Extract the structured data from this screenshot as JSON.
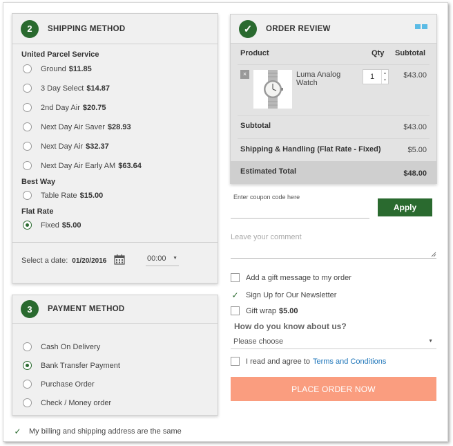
{
  "shipping": {
    "step": "2",
    "title": "SHIPPING METHOD",
    "groups": [
      {
        "label": "United Parcel Service",
        "options": [
          {
            "label": "Ground",
            "price": "$11.85",
            "selected": false
          },
          {
            "label": "3 Day Select",
            "price": "$14.87",
            "selected": false
          },
          {
            "label": "2nd Day Air",
            "price": "$20.75",
            "selected": false
          },
          {
            "label": "Next Day Air Saver",
            "price": "$28.93",
            "selected": false
          },
          {
            "label": "Next Day Air",
            "price": "$32.37",
            "selected": false
          },
          {
            "label": "Next Day Air Early AM",
            "price": "$63.64",
            "selected": false
          }
        ]
      },
      {
        "label": "Best Way",
        "options": [
          {
            "label": "Table Rate",
            "price": "$15.00",
            "selected": false
          }
        ]
      },
      {
        "label": "Flat Rate",
        "options": [
          {
            "label": "Fixed",
            "price": "$5.00",
            "selected": true
          }
        ]
      }
    ],
    "date_label": "Select a date:",
    "date_value": "01/20/2016",
    "time_value": "00:00"
  },
  "payment": {
    "step": "3",
    "title": "PAYMENT METHOD",
    "options": [
      {
        "label": "Cash On Delivery",
        "selected": false
      },
      {
        "label": "Bank Transfer Payment",
        "selected": true
      },
      {
        "label": "Purchase Order",
        "selected": false
      },
      {
        "label": "Check / Money order",
        "selected": false
      }
    ]
  },
  "billing_same": "My billing and shipping address are the same",
  "review": {
    "title": "ORDER REVIEW",
    "col_product": "Product",
    "col_qty": "Qty",
    "col_subtotal": "Subtotal",
    "item_name_1": "Luma Analog",
    "item_name_2": "Watch",
    "item_qty": "1",
    "item_subtotal": "$43.00",
    "remove_icon": "×",
    "subtotal_label": "Subtotal",
    "subtotal_value": "$43.00",
    "shipping_label": "Shipping & Handling (Flat Rate - Fixed)",
    "shipping_value": "$5.00",
    "total_label": "Estimated Total",
    "total_value": "$48.00"
  },
  "coupon": {
    "placeholder": "Enter coupon code here",
    "apply": "Apply"
  },
  "comment": {
    "placeholder": "Leave your comment"
  },
  "gift_message": "Add a gift message to my order",
  "newsletter": "Sign Up for Our Newsletter",
  "gift_wrap_label": "Gift wrap",
  "gift_wrap_price": "$5.00",
  "how_know": "How do you know about us?",
  "please_choose": "Please choose",
  "agree_text": "I read and agree to",
  "terms_link": "Terms and Conditions",
  "place_order": "PLACE ORDER NOW",
  "colors": {
    "accent": "#2a6a2f",
    "place_order": "#fa9d7f",
    "link": "#1a73b8"
  }
}
